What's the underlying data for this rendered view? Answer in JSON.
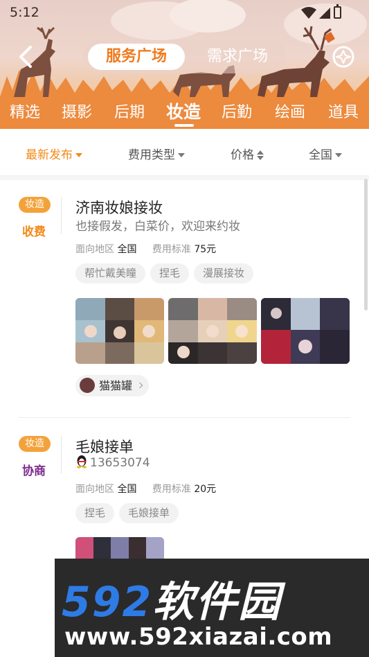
{
  "status_bar": {
    "time": "5:12"
  },
  "header": {
    "segments": [
      {
        "label": "服务广场",
        "active": true
      },
      {
        "label": "需求广场",
        "active": false
      }
    ],
    "categories": [
      {
        "label": "精选"
      },
      {
        "label": "摄影"
      },
      {
        "label": "后期"
      },
      {
        "label": "妆造",
        "active": true
      },
      {
        "label": "后勤"
      },
      {
        "label": "绘画"
      },
      {
        "label": "道具"
      }
    ]
  },
  "filters": [
    {
      "label": "最新发布",
      "active": true
    },
    {
      "label": "费用类型"
    },
    {
      "label": "价格"
    },
    {
      "label": "全国"
    }
  ],
  "listings": [
    {
      "type_badge": "妆造",
      "fee_type": "收费",
      "fee_color": "#f28a1a",
      "title": "济南妆娘接妆",
      "subtitle": "也接假发，白菜价，欢迎来约妆",
      "area_label": "面向地区",
      "area": "全国",
      "price_label": "费用标准",
      "price": "75元",
      "tags": [
        "帮忙戴美瞳",
        "捏毛",
        "漫展接妆"
      ],
      "author": "猫猫罐"
    },
    {
      "type_badge": "妆造",
      "fee_type": "协商",
      "fee_color": "#7b2a8c",
      "title": "毛娘接单",
      "qq": "13653074",
      "area_label": "面向地区",
      "area": "全国",
      "price_label": "费用标准",
      "price": "20元",
      "tags": [
        "捏毛",
        "毛娘接单"
      ]
    }
  ],
  "watermark": {
    "brand_num": "592",
    "brand_cn": "软件园",
    "url": "www.592xiazai.com"
  },
  "colors": {
    "accent": "#f28a1a",
    "header_orange": "#f0883a",
    "badge": "#f3a23a"
  }
}
